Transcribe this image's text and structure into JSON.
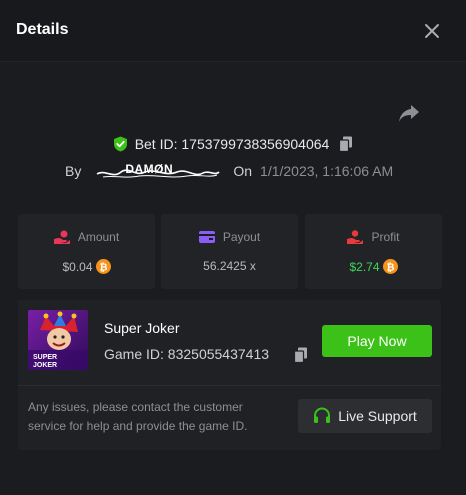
{
  "header": {
    "title": "Details"
  },
  "bet": {
    "id_text": "Bet ID: 1753799738356904064",
    "by_label": "By",
    "username": "DAMØN",
    "on_label": "On",
    "date": "1/1/2023, 1:16:06 AM"
  },
  "stats": {
    "amount": {
      "label": "Amount",
      "value": "$0.04"
    },
    "payout": {
      "label": "Payout",
      "value": "56.2425 x"
    },
    "profit": {
      "label": "Profit",
      "value": "$2.74"
    }
  },
  "game": {
    "thumb_line1": "SUPER",
    "thumb_line2": "JOKER",
    "name": "Super Joker",
    "id_text": "Game ID: 8325055437413",
    "play_label": "Play Now",
    "issue_text": "Any issues, please contact the customer service for help and provide the game ID.",
    "support_label": "Live Support"
  },
  "colors": {
    "background": "#1b1c1f",
    "card": "#222327",
    "accent_green": "#3bc117",
    "profit_green": "#3fd55d",
    "amount_icon": "#e8375a",
    "payout_icon": "#8b5cf6",
    "profit_icon": "#e83a3a",
    "coin": "#f7931a"
  },
  "icons": {
    "close": "close-icon",
    "share": "share-icon",
    "verified": "shield-check-icon",
    "copy": "copy-icon",
    "amount": "hand-chip-icon",
    "payout": "wallet-icon",
    "profit": "hand-money-icon",
    "coin": "bitcoin-icon",
    "support": "headset-icon"
  }
}
